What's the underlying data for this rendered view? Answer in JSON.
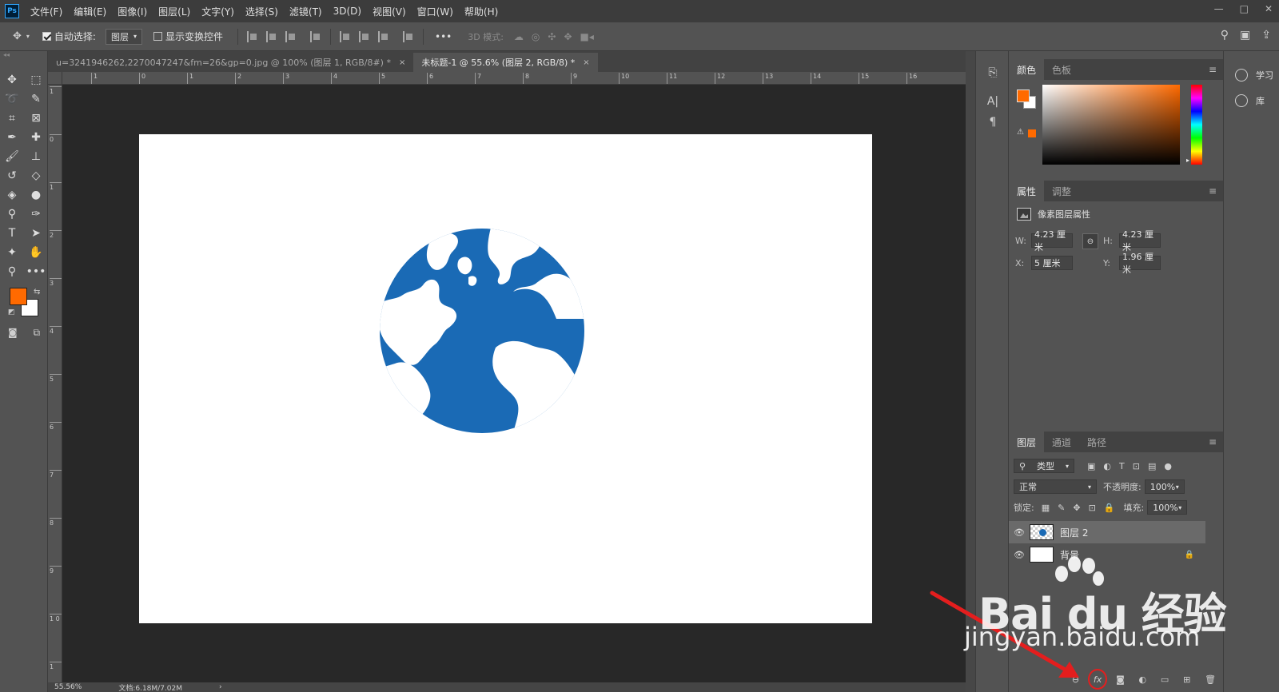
{
  "app": {
    "logo": "Ps",
    "menu": [
      "文件(F)",
      "编辑(E)",
      "图像(I)",
      "图层(L)",
      "文字(Y)",
      "选择(S)",
      "滤镜(T)",
      "3D(D)",
      "视图(V)",
      "窗口(W)",
      "帮助(H)"
    ],
    "window_controls": [
      "—",
      "□",
      "✕"
    ]
  },
  "options_bar": {
    "auto_select_label": "自动选择:",
    "auto_select_checked": true,
    "auto_select_target": "图层",
    "show_transform_label": "显示变换控件",
    "show_transform_checked": false,
    "more_label": "•••",
    "mode3d_label": "3D 模式:"
  },
  "tabs": [
    {
      "title": "u=3241946262,2270047247&fm=26&gp=0.jpg @ 100% (图层 1, RGB/8#) *",
      "close": "×",
      "active": false
    },
    {
      "title": "未标题-1 @ 55.6% (图层 2, RGB/8) *",
      "close": "×",
      "active": true
    }
  ],
  "rulers": {
    "top": [
      "1",
      "0",
      "1",
      "2",
      "3",
      "4",
      "5",
      "6",
      "7",
      "8",
      "9",
      "10",
      "11",
      "12",
      "13",
      "14",
      "15",
      "16"
    ],
    "left": [
      "1",
      "0",
      "1",
      "2",
      "3",
      "4",
      "5",
      "6",
      "7",
      "8",
      "9",
      "1 0",
      "1"
    ]
  },
  "status_bar": {
    "zoom": "55.56%",
    "doc_size": "文档:6.18M/7.02M",
    "arrow": "›"
  },
  "colors": {
    "foreground": "#ff6a00",
    "background": "#ffffff",
    "globe_blue": "#1a6ab5",
    "annotation_red": "#e41e1e"
  },
  "color_panel": {
    "tabs": [
      "颜色",
      "色板"
    ],
    "menu_icon": "≡",
    "warning_icon": "⚠"
  },
  "properties_panel": {
    "tabs": [
      "属性",
      "调整"
    ],
    "menu_icon": "≡",
    "title": "像素图层属性",
    "w_label": "W:",
    "w_value": "4.23 厘米",
    "h_label": "H:",
    "h_value": "4.23 厘米",
    "x_label": "X:",
    "x_value": "5 厘米",
    "y_label": "Y:",
    "y_value": "1.96 厘米",
    "link_icon": "⊖"
  },
  "layers_panel": {
    "tabs": [
      "图层",
      "通道",
      "路径"
    ],
    "menu_icon": "≡",
    "filter_kind": "类型",
    "blend_mode": "正常",
    "opacity_label": "不透明度:",
    "opacity_value": "100%",
    "lock_label": "锁定:",
    "fill_label": "填充:",
    "fill_value": "100%",
    "layers": [
      {
        "name": "图层 2",
        "selected": true,
        "visible_icon": "👁"
      },
      {
        "name": "背景",
        "selected": false,
        "visible_icon": "👁",
        "locked_icon": "🔒"
      }
    ],
    "footer_fx": "fx"
  },
  "right_dock": {
    "learn_label": "学习",
    "library_label": "库"
  },
  "watermark": {
    "main": "Bai du 经验",
    "url": "jingyan.baidu.com"
  }
}
